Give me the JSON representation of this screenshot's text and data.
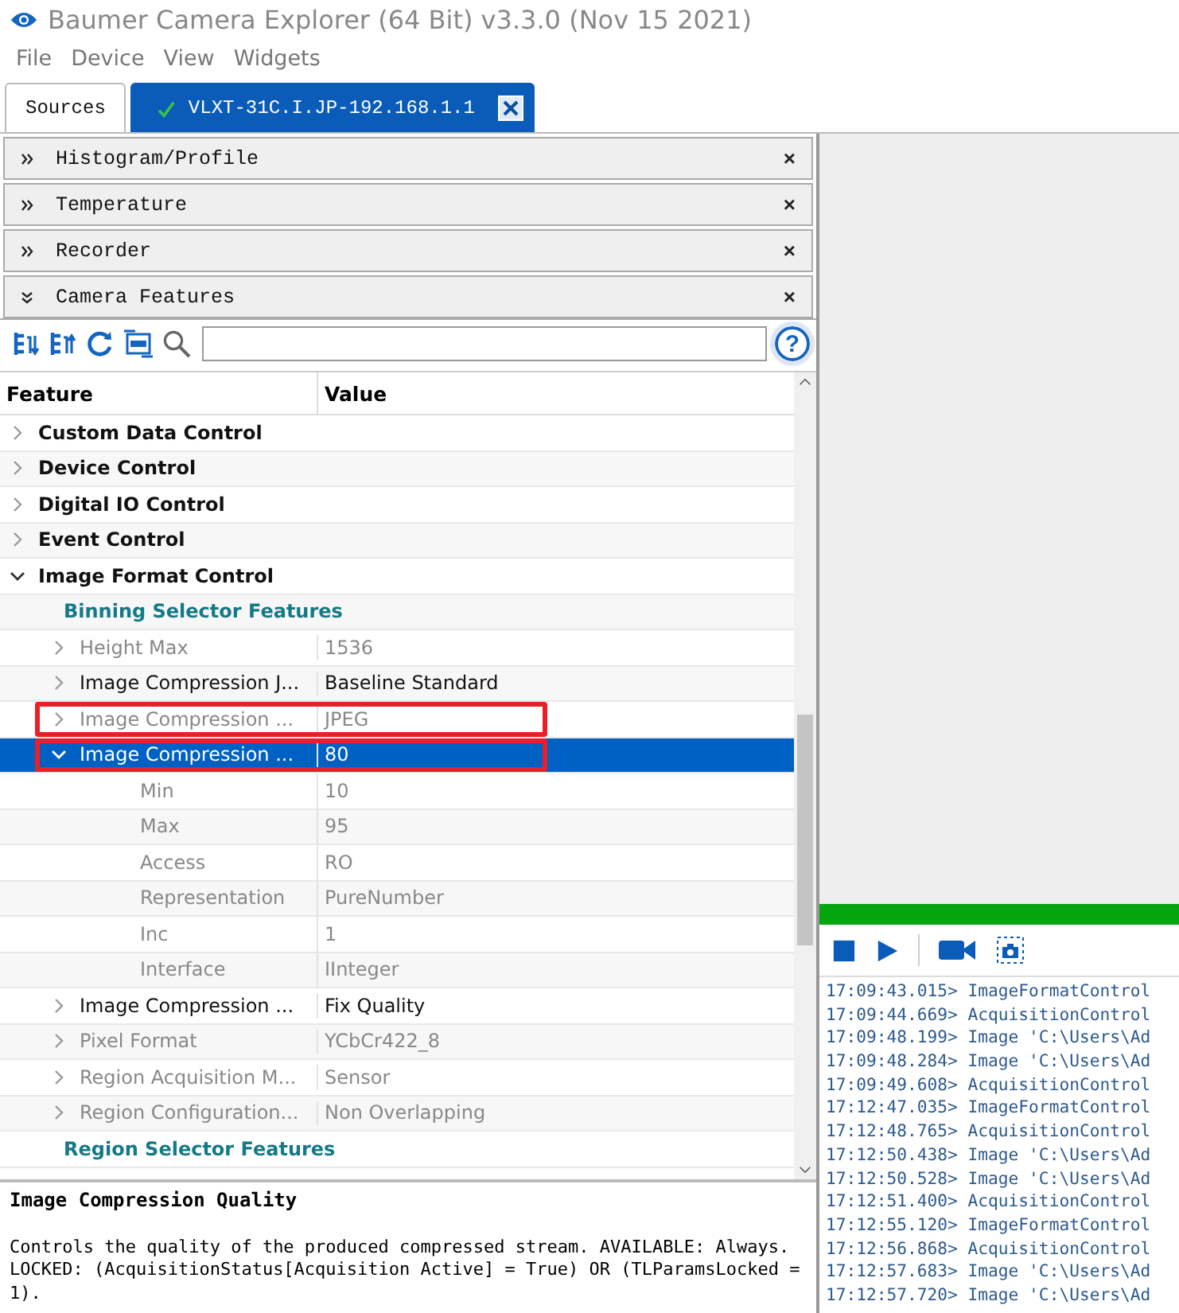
{
  "window": {
    "title": "Baumer Camera Explorer (64 Bit) v3.3.0 (Nov 15 2021)"
  },
  "menu": [
    "File",
    "Device",
    "View",
    "Widgets"
  ],
  "tabs": [
    {
      "label": "Sources",
      "selected": false,
      "connected": false
    },
    {
      "label": "VLXT-31C.I.JP-192.168.1.1",
      "selected": true,
      "connected": true
    }
  ],
  "panels": [
    {
      "title": "Histogram/Profile",
      "expanded": false,
      "close": "×"
    },
    {
      "title": "Temperature",
      "expanded": false,
      "close": "×"
    },
    {
      "title": "Recorder",
      "expanded": false,
      "close": "×"
    },
    {
      "title": "Camera Features",
      "expanded": true,
      "close": "×"
    }
  ],
  "feature_toolbar": {
    "help": "?"
  },
  "tree": {
    "columns": [
      "Feature",
      "Value"
    ],
    "rows": [
      {
        "kind": "category",
        "name": "Custom Data Control",
        "expanded": false
      },
      {
        "kind": "category",
        "name": "Device Control",
        "expanded": false
      },
      {
        "kind": "category",
        "name": "Digital IO Control",
        "expanded": false
      },
      {
        "kind": "category",
        "name": "Event Control",
        "expanded": false
      },
      {
        "kind": "category",
        "name": "Image Format Control",
        "expanded": true,
        "children": [
          {
            "kind": "group",
            "name": "Binning Selector Features",
            "expanded": false
          },
          {
            "kind": "feature",
            "name": "Height Max",
            "value": "1536",
            "expanded": false,
            "disabled": true,
            "selected": false,
            "highlighted": false
          },
          {
            "kind": "feature",
            "name": "Image Compression J...",
            "value": "Baseline Standard",
            "expanded": false,
            "disabled": false,
            "selected": false,
            "highlighted": false
          },
          {
            "kind": "feature",
            "name": "Image Compression ...",
            "value": "JPEG",
            "expanded": false,
            "disabled": true,
            "selected": false,
            "highlighted": true
          },
          {
            "kind": "feature",
            "name": "Image Compression ...",
            "value": "80",
            "expanded": true,
            "disabled": false,
            "selected": true,
            "highlighted": true,
            "children": [
              {
                "kind": "property",
                "name": "Min",
                "value": "10"
              },
              {
                "kind": "property",
                "name": "Max",
                "value": "95"
              },
              {
                "kind": "property",
                "name": "Access",
                "value": "RO"
              },
              {
                "kind": "property",
                "name": "Representation",
                "value": "PureNumber"
              },
              {
                "kind": "property",
                "name": "Inc",
                "value": "1"
              },
              {
                "kind": "property",
                "name": "Interface",
                "value": "IInteger"
              }
            ]
          },
          {
            "kind": "feature",
            "name": "Image Compression ...",
            "value": "Fix Quality",
            "expanded": false,
            "disabled": false,
            "selected": false,
            "highlighted": false
          },
          {
            "kind": "feature",
            "name": "Pixel Format",
            "value": "YCbCr422_8",
            "expanded": false,
            "disabled": true,
            "selected": false,
            "highlighted": false
          },
          {
            "kind": "feature",
            "name": "Region Acquisition M...",
            "value": "Sensor",
            "expanded": false,
            "disabled": true,
            "selected": false,
            "highlighted": false
          },
          {
            "kind": "feature",
            "name": "Region Configuration...",
            "value": "Non Overlapping",
            "expanded": false,
            "disabled": true,
            "selected": false,
            "highlighted": false
          },
          {
            "kind": "group",
            "name": "Region Selector Features",
            "expanded": false
          }
        ]
      }
    ]
  },
  "description": {
    "title": "Image Compression Quality",
    "text": "Controls the quality of the produced compressed stream. AVAILABLE: Always. LOCKED: (AcquisitionStatus[Acquisition Active] = True) OR (TLParamsLocked = 1)."
  },
  "log": [
    "17:09:43.015> ImageFormatControl",
    "17:09:44.669> AcquisitionControl",
    "17:09:48.199> Image 'C:\\Users\\Ad",
    "17:09:48.284> Image 'C:\\Users\\Ad",
    "17:09:49.608> AcquisitionControl",
    "17:12:47.035> ImageFormatControl",
    "17:12:48.765> AcquisitionControl",
    "17:12:50.438> Image 'C:\\Users\\Ad",
    "17:12:50.528> Image 'C:\\Users\\Ad",
    "17:12:51.400> AcquisitionControl",
    "17:12:55.120> ImageFormatControl",
    "17:12:56.868> AcquisitionControl",
    "17:12:57.683> Image 'C:\\Users\\Ad",
    "17:12:57.720> Image 'C:\\Users\\Ad"
  ]
}
